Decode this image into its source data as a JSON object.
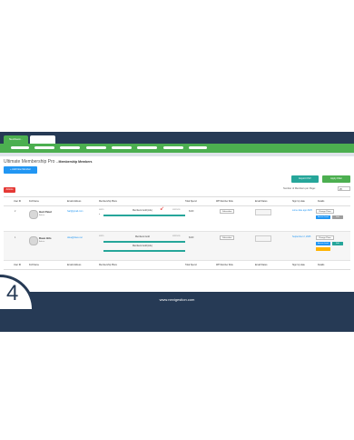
{
  "browser": {
    "active_tab": "NextGest...",
    "dots": [
      "#e74c3c",
      "#4caf50",
      "#2196f3"
    ]
  },
  "page": {
    "title": "Ultimate Membership Pro",
    "subtitle": "- Membership Members"
  },
  "toolbar": {
    "add_label": "Add New Member",
    "export_label": "Export CSV",
    "apply_label": "Apply Filter",
    "perpage_label": "Number of Members per Page:",
    "perpage_value": "25",
    "actions_label": "Actions"
  },
  "table": {
    "headers": [
      "User ID",
      "Full Name",
      "Email Address",
      "Membership Plans",
      "Total Spend",
      "WP Member Role",
      "Email Status",
      "Sign Up date",
      "Details"
    ],
    "rows": [
      {
        "id": "2",
        "name": "Hari Patel",
        "role": "Admin",
        "email": "hari@gmail.com",
        "plan_start": "08/25",
        "plan_name": "Members Gold (Life)",
        "plan_end": "09/25/26",
        "total_spend": "$449",
        "wp_role": "Subscriber",
        "signup": "some date ago 2025",
        "actions": [
          "Change Plans",
          "Access Level",
          "Edit"
        ]
      },
      {
        "id": "1",
        "name": "Dave Hils",
        "role": "Admin",
        "email": "dave@dave.net",
        "plan_start": "09/25",
        "plan_name": "Members Gold",
        "plan_end": "09/25/26",
        "plan2_name": "Members Gold (Life)",
        "total_spend": "$449",
        "wp_role": "Subscriber",
        "signup": "September 2, 2025",
        "actions": [
          "Change Plans",
          "Access Level",
          "Edit"
        ]
      }
    ]
  },
  "footer_bar": {
    "step_number": "4",
    "site_url": "www.nextgestion.com"
  }
}
